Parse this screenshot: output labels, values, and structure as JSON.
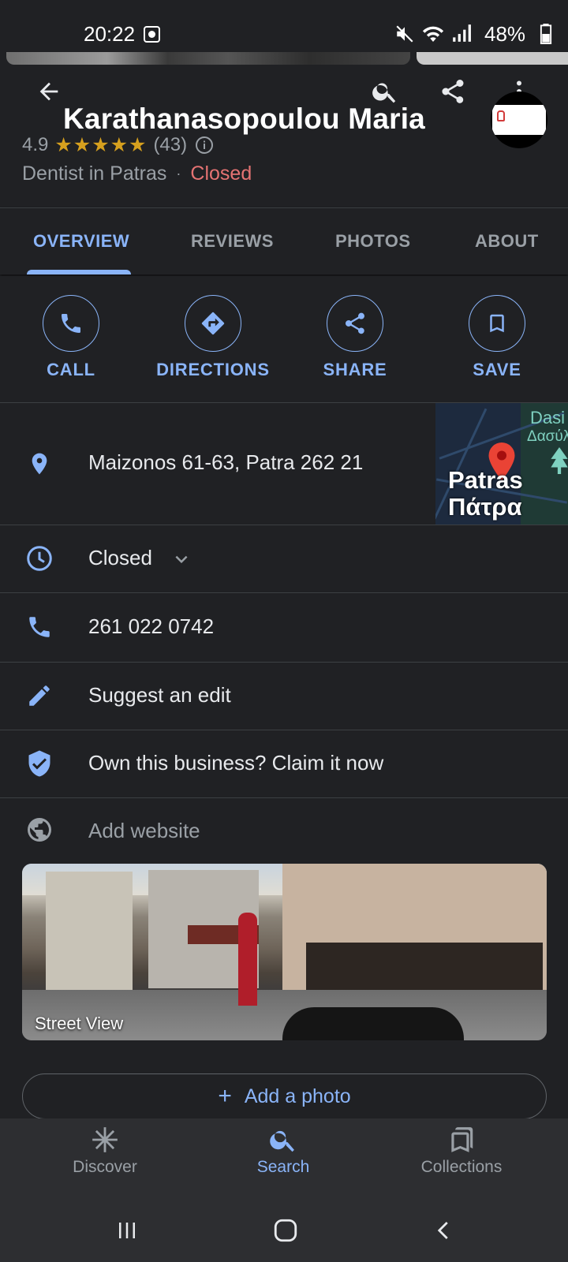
{
  "status_bar": {
    "time": "20:22",
    "battery": "48%"
  },
  "header": {
    "title": "Karathanasopoulou Maria",
    "rating": "4.9",
    "stars": "★★★★★",
    "review_count": "(43)",
    "category": "Dentist in Patras",
    "separator": "·",
    "status": "Closed"
  },
  "tabs": [
    {
      "label": "OVERVIEW",
      "active": true
    },
    {
      "label": "REVIEWS"
    },
    {
      "label": "PHOTOS"
    },
    {
      "label": "ABOUT"
    }
  ],
  "actions": [
    {
      "label": "CALL",
      "icon": "phone-icon"
    },
    {
      "label": "DIRECTIONS",
      "icon": "directions-icon"
    },
    {
      "label": "SHARE",
      "icon": "share-icon"
    },
    {
      "label": "SAVE",
      "icon": "bookmark-icon"
    }
  ],
  "info": {
    "address": "Maizonos 61-63, Patra 262 21",
    "hours_status": "Closed",
    "phone": "261 022 0742",
    "suggest_edit": "Suggest an edit",
    "claim": "Own this business? Claim it now",
    "website": "Add website"
  },
  "map": {
    "label_en": "Patras",
    "label_gr": "Πάτρα",
    "dasi_en": "Dasi",
    "dasi_gr": "Δασύλ"
  },
  "street_view": {
    "label": "Street View"
  },
  "add_photo": {
    "label": "Add a photo"
  },
  "bottom_nav": [
    {
      "label": "Discover",
      "icon": "discover-icon"
    },
    {
      "label": "Search",
      "icon": "search-icon",
      "active": true
    },
    {
      "label": "Collections",
      "icon": "collections-icon"
    }
  ],
  "colors": {
    "accent": "#8ab4f8",
    "closed": "#e57373",
    "star": "#d6a01e",
    "background": "#202124"
  }
}
